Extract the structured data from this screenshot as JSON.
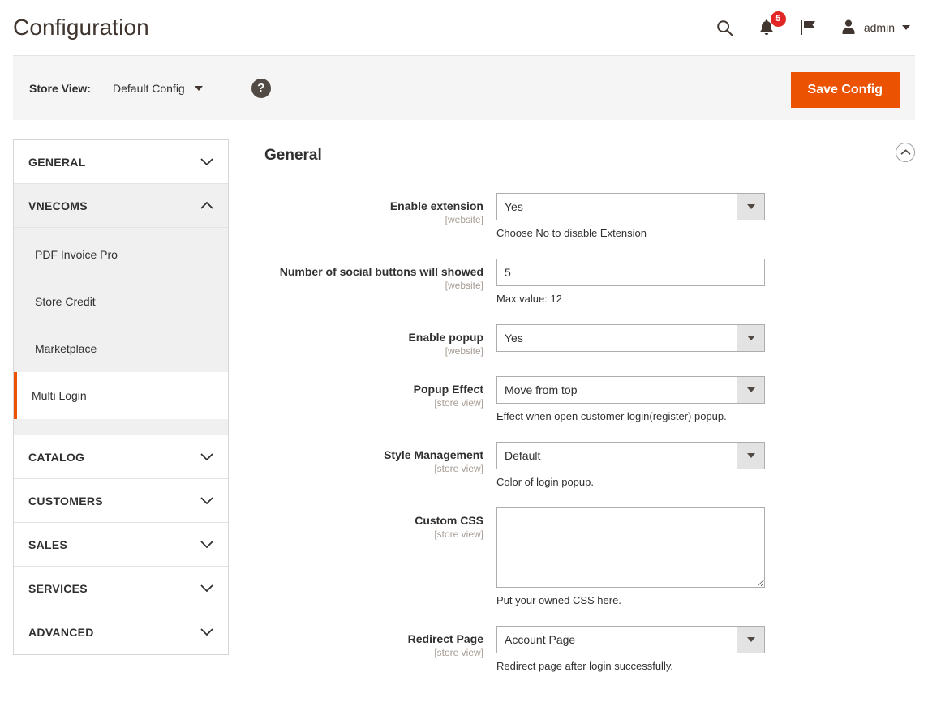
{
  "header": {
    "title": "Configuration",
    "icons": {
      "search": "search-icon",
      "notifications": "notification-bell-icon",
      "notifications_count": "5",
      "flag": "flag-icon",
      "user": "user-avatar-icon"
    },
    "user_name": "admin"
  },
  "store_bar": {
    "label": "Store View:",
    "selected_scope": "Default Config",
    "help": "?",
    "save_label": "Save Config"
  },
  "sidebar": {
    "sections": [
      {
        "label": "GENERAL",
        "expanded": false
      },
      {
        "label": "VNECOMS",
        "expanded": true
      },
      {
        "label": "CATALOG",
        "expanded": false
      },
      {
        "label": "CUSTOMERS",
        "expanded": false
      },
      {
        "label": "SALES",
        "expanded": false
      },
      {
        "label": "SERVICES",
        "expanded": false
      },
      {
        "label": "ADVANCED",
        "expanded": false
      }
    ],
    "vnecoms_items": [
      {
        "label": "PDF Invoice Pro",
        "active": false
      },
      {
        "label": "Store Credit",
        "active": false
      },
      {
        "label": "Marketplace",
        "active": false
      },
      {
        "label": "Multi Login",
        "active": true
      }
    ]
  },
  "main": {
    "section_title": "General",
    "collapse_icon": "chevron-up-circle-icon",
    "fields": [
      {
        "label": "Enable extension",
        "scope": "[website]",
        "type": "select",
        "value": "Yes",
        "note": "Choose No to disable Extension"
      },
      {
        "label": "Number of social buttons will showed",
        "scope": "[website]",
        "type": "text",
        "value": "5",
        "note": "Max value: 12"
      },
      {
        "label": "Enable popup",
        "scope": "[website]",
        "type": "select",
        "value": "Yes",
        "note": ""
      },
      {
        "label": "Popup Effect",
        "scope": "[store view]",
        "type": "select",
        "value": "Move from top",
        "note": "Effect when open customer login(register) popup."
      },
      {
        "label": "Style Management",
        "scope": "[store view]",
        "type": "select",
        "value": "Default",
        "note": "Color of login popup."
      },
      {
        "label": "Custom CSS",
        "scope": "[store view]",
        "type": "textarea",
        "value": "",
        "note": "Put your owned CSS here."
      },
      {
        "label": "Redirect Page",
        "scope": "[store view]",
        "type": "select",
        "value": "Account Page",
        "note": "Redirect page after login successfully."
      }
    ]
  },
  "colors": {
    "accent_orange": "#eb5202",
    "badge_red": "#e22626",
    "help_circle": "#514943",
    "panel_gray": "#f0f0f0",
    "bar_gray": "#f5f5f5"
  }
}
